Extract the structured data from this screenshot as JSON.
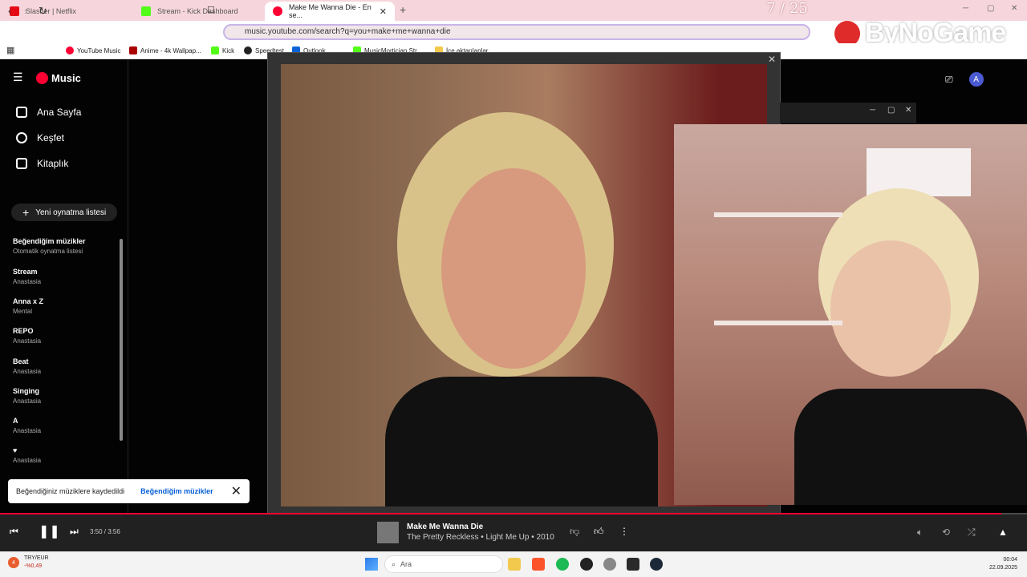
{
  "browser": {
    "tabs": [
      {
        "label": "Slasher | Netflix",
        "color": "#e50914"
      },
      {
        "label": "Stream - Kick Dashboard",
        "color": "#53fc18"
      },
      {
        "label": "Make Me Wanna Die - En se...",
        "color": "#ff0033"
      }
    ],
    "overlay_counter": "7 / 25",
    "url": "music.youtube.com/search?q=you+make+me+wanna+die",
    "bookmarks": [
      "YouTube Music",
      "Anime - 4k Wallpap...",
      "Kick",
      "Speedtest",
      "Outlook",
      "MusicMortician Str...",
      "İçe aktarılanlar"
    ],
    "brand": "ByNoGame"
  },
  "sidebar": {
    "logo": "Music",
    "nav": [
      {
        "label": "Ana Sayfa",
        "icon": "home-icon"
      },
      {
        "label": "Keşfet",
        "icon": "compass-icon"
      },
      {
        "label": "Kitaplık",
        "icon": "library-icon"
      }
    ],
    "new_playlist": "Yeni oynatma listesi",
    "playlists": [
      {
        "title": "Beğendiğim müzikler",
        "sub": "Otomatik oynatma listesi"
      },
      {
        "title": "Stream",
        "sub": "Anastasia"
      },
      {
        "title": "Anna x Z",
        "sub": "Mental"
      },
      {
        "title": "REPO",
        "sub": "Anastasia"
      },
      {
        "title": "Beat",
        "sub": "Anastasia"
      },
      {
        "title": "Singing",
        "sub": "Anastasia"
      },
      {
        "title": "A",
        "sub": "Anastasia"
      },
      {
        "title": "♥",
        "sub": "Anastasia"
      }
    ]
  },
  "header": {
    "avatar_letter": "A"
  },
  "toast": {
    "message": "Beğendiğiniz müziklere kaydedildi",
    "action": "Beğendiğim müzikler"
  },
  "player": {
    "time": "3:50 / 3:56",
    "progress": 0.975,
    "title": "Make Me Wanna Die",
    "subtitle": "The Pretty Reckless • Light Me Up • 2010"
  },
  "taskbar": {
    "ticker_name": "TRY/EUR",
    "ticker_value": "-%0,49",
    "badge": "4",
    "search_placeholder": "Ara",
    "time": "00:04",
    "date": "22.09.2025"
  }
}
